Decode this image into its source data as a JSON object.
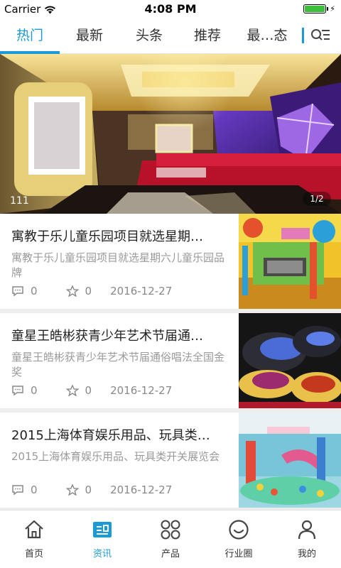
{
  "status_bar": {
    "carrier": "Carrier",
    "time": "4:08 PM",
    "battery_level": 1.0
  },
  "tabs": [
    {
      "label": "热门",
      "active": true
    },
    {
      "label": "最新",
      "active": false
    },
    {
      "label": "头条",
      "active": false
    },
    {
      "label": "推荐",
      "active": false
    },
    {
      "label": "最…态",
      "active": false
    }
  ],
  "banner": {
    "caption": "111",
    "pager": "1/2"
  },
  "news": [
    {
      "title": "寓教于乐儿童乐园项目就选星期…",
      "summary": "寓教于乐儿童乐园项目就选星期六儿童乐园品牌",
      "comments": "0",
      "favorites": "0",
      "date": "2016-12-27"
    },
    {
      "title": "童星王皓彬获青少年艺术节届通…",
      "summary": "童星王皓彬获青少年艺术节届通俗唱法全国金奖",
      "comments": "0",
      "favorites": "0",
      "date": "2016-12-27"
    },
    {
      "title": "2015上海体育娱乐用品、玩具类…",
      "summary": "2015上海体育娱乐用品、玩具类开关展览会",
      "comments": "0",
      "favorites": "0",
      "date": "2016-12-27"
    }
  ],
  "bottom_nav": [
    {
      "label": "首页",
      "icon": "home-icon",
      "active": false
    },
    {
      "label": "资讯",
      "icon": "news-icon",
      "active": true
    },
    {
      "label": "产品",
      "icon": "grid-icon",
      "active": false
    },
    {
      "label": "行业圈",
      "icon": "circle-face-icon",
      "active": false
    },
    {
      "label": "我的",
      "icon": "person-icon",
      "active": false
    }
  ],
  "colors": {
    "accent": "#1a9bd7",
    "battery": "#3cbf3a"
  }
}
